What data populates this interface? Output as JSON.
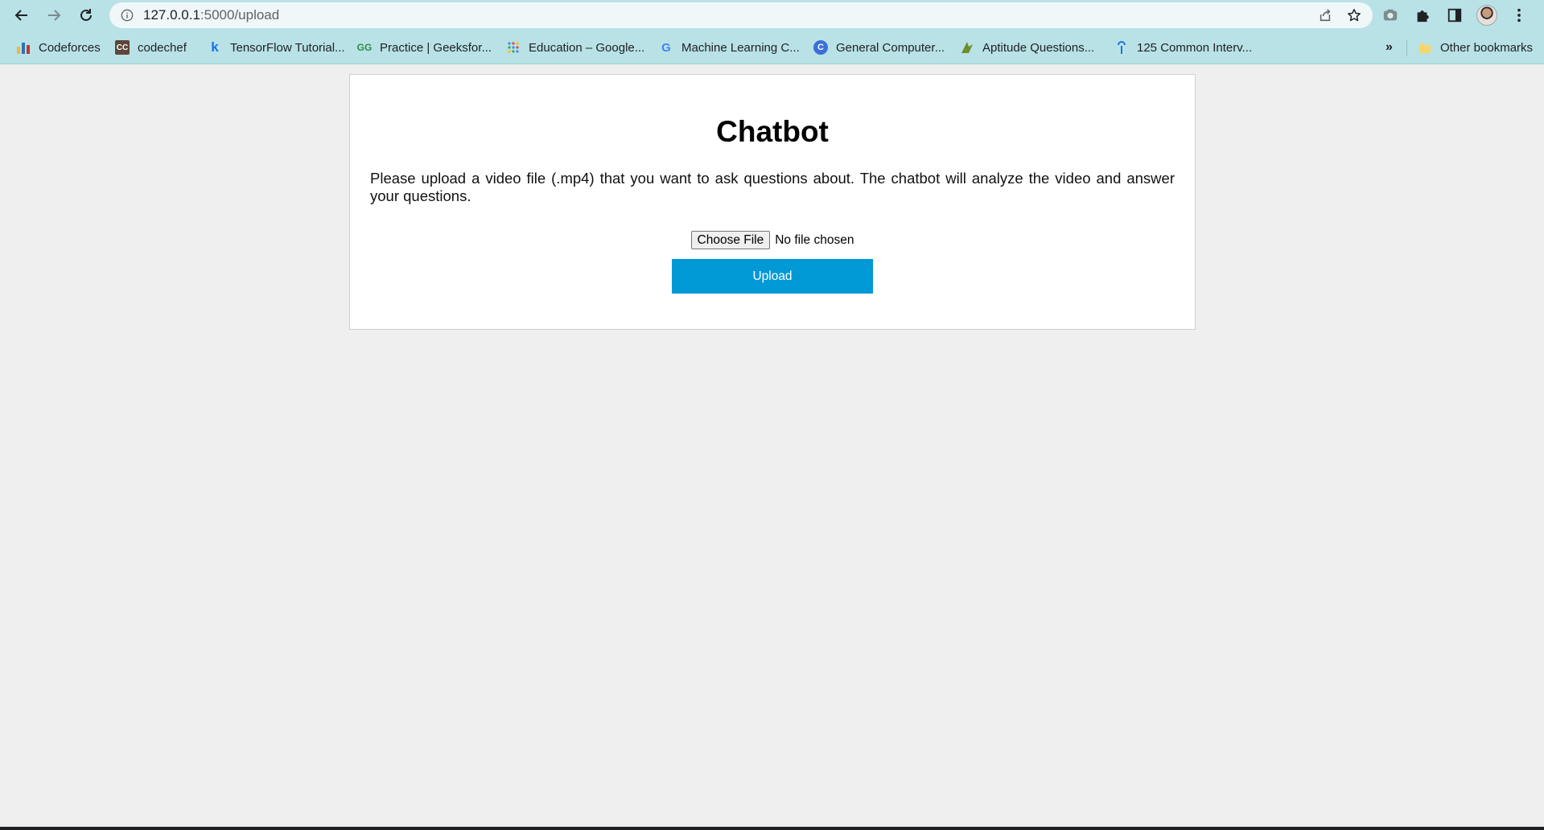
{
  "browser": {
    "url_host": "127.0.0.1",
    "url_path": ":5000/upload",
    "bookmarks": [
      {
        "label": "Codeforces",
        "icon": "codeforces-icon"
      },
      {
        "label": "codechef",
        "icon": "codechef-icon"
      },
      {
        "label": "TensorFlow Tutorial...",
        "icon": "tensorflow-icon"
      },
      {
        "label": "Practice | Geeksfor...",
        "icon": "geeksforgeeks-icon"
      },
      {
        "label": "Education – Google...",
        "icon": "google-education-icon"
      },
      {
        "label": "Machine Learning C...",
        "icon": "google-icon"
      },
      {
        "label": "General Computer...",
        "icon": "c-icon"
      },
      {
        "label": "Aptitude Questions...",
        "icon": "aptitude-icon"
      },
      {
        "label": "125 Common Interv...",
        "icon": "interview-icon"
      }
    ],
    "more_bookmarks": "»",
    "other_bookmarks": "Other bookmarks"
  },
  "page": {
    "title": "Chatbot",
    "description": "Please upload a video file (.mp4) that you want to ask questions about. The chatbot will analyze the video and answer your questions.",
    "choose_file_label": "Choose File",
    "no_file_text": "No file chosen",
    "upload_label": "Upload"
  },
  "colors": {
    "chrome": "#b8e2e6",
    "upload_button": "#0099d6",
    "page_background": "#efefef"
  }
}
